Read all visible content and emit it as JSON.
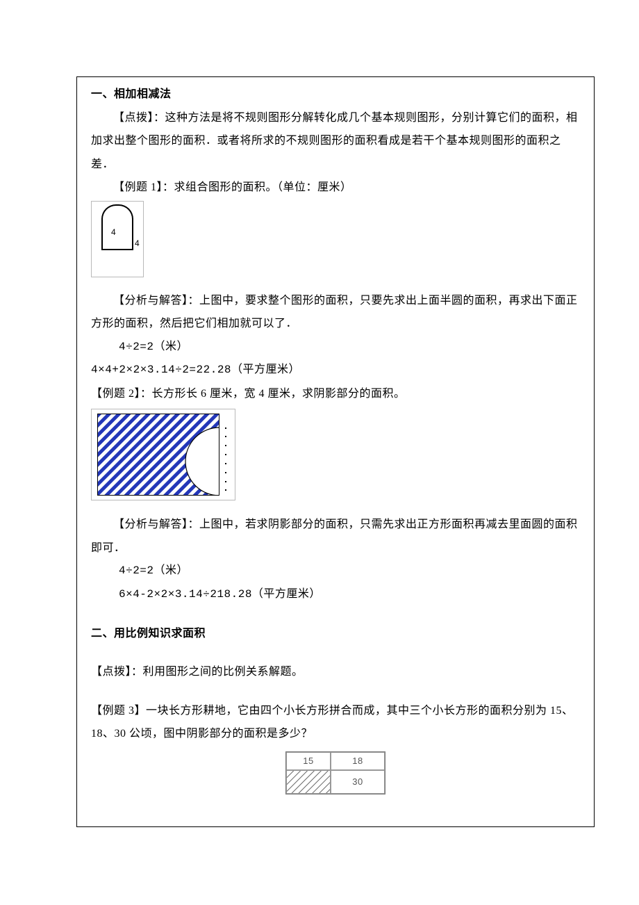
{
  "section1": {
    "heading": "一、相加相减法",
    "tip_label": "【点拨】",
    "tip_text": "：这种方法是将不规则图形分解转化成几个基本规则图形，分别计算它们的面积，相加求出整个图形的面积．或者将所求的不规则图形的面积看成是若干个基本规则图形的面积之差．",
    "ex1_label": "【例题 1】",
    "ex1_text": "：求组合图形的面积。（单位：厘米）",
    "ex1_fig": {
      "top_label": "4",
      "side_label": "4"
    },
    "ex1_ans_label": "【分析与解答】",
    "ex1_ans_text": "：上图中，要求整个图形的面积，只要先求出上面半圆的面积，再求出下面正方形的面积，然后把它们相加就可以了．",
    "ex1_calc1": "4÷2=2（米）",
    "ex1_calc2": "4×4+2×2×3.14÷2=22.28（平方厘米）",
    "ex2_label": "【例题 2】",
    "ex2_text": "：长方形长 6 厘米，宽 4 厘米，求阴影部分的面积。",
    "ex2_ans_label": "【分析与解答】",
    "ex2_ans_text": "：上图中，若求阴影部分的面积，只需先求出正方形面积再减去里面圆的面积即可．",
    "ex2_calc1": "4÷2=2（米）",
    "ex2_calc2": "6×4-2×2×3.14÷218.28（平方厘米）"
  },
  "section2": {
    "heading": "二、用比例知识求面积",
    "tip_label": "【点拨】",
    "tip_text": "：利用图形之间的比例关系解题。",
    "ex3_label": "【例题 3】",
    "ex3_text": "一块长方形耕地，它由四个小长方形拼合而成，其中三个小长方形的面积分别为 15、18、30 公顷，图中阴影部分的面积是多少？",
    "ex3_fig": {
      "tl": "15",
      "tr": "18",
      "br": "30"
    }
  }
}
